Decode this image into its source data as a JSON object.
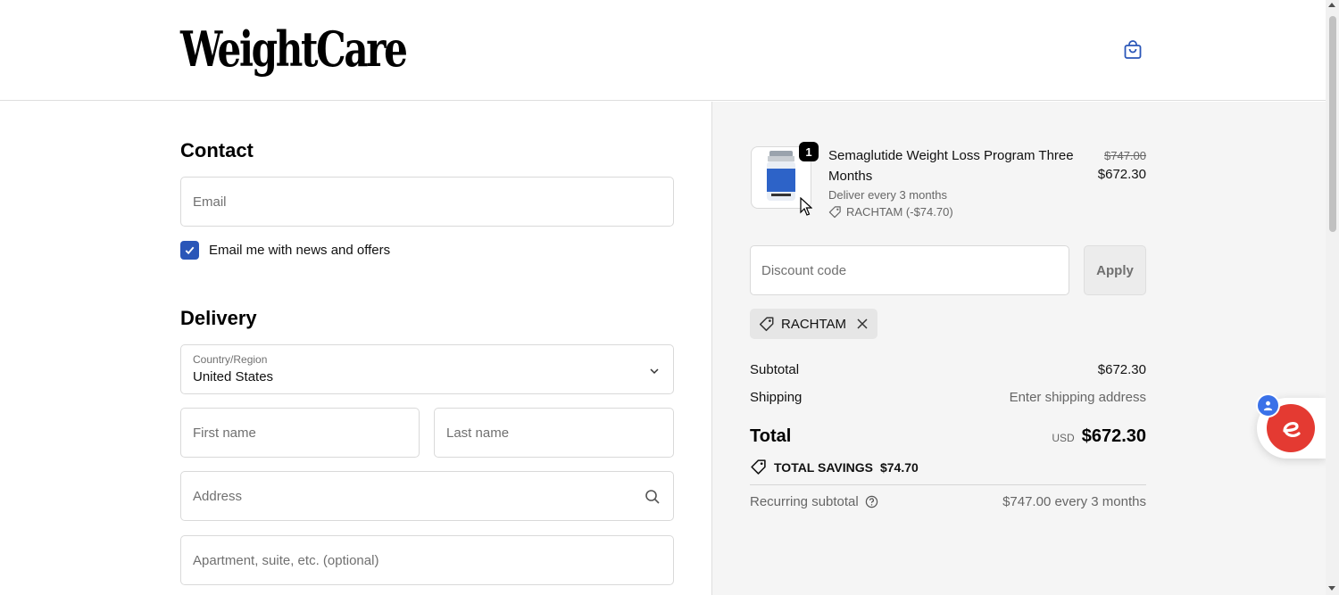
{
  "header": {
    "logo_text": "WeightCare",
    "cart_icon": "shopping-bag-icon"
  },
  "contact": {
    "title": "Contact",
    "email_placeholder": "Email",
    "email_value": "",
    "newsletter_label": "Email me with news and offers",
    "newsletter_checked": true
  },
  "delivery": {
    "title": "Delivery",
    "country_label": "Country/Region",
    "country_value": "United States",
    "first_name_placeholder": "First name",
    "last_name_placeholder": "Last name",
    "address_placeholder": "Address",
    "apartment_placeholder": "Apartment, suite, etc. (optional)"
  },
  "order": {
    "product": {
      "quantity": "1",
      "name": "Semaglutide Weight Loss Program Three Months",
      "subscription": "Deliver every 3 months",
      "discount_line": "RACHTAM (-$74.70)",
      "price_original": "$747.00",
      "price_current": "$672.30"
    },
    "discount_placeholder": "Discount code",
    "apply_label": "Apply",
    "applied_code": "RACHTAM",
    "subtotal_label": "Subtotal",
    "subtotal_value": "$672.30",
    "shipping_label": "Shipping",
    "shipping_value": "Enter shipping address",
    "total_label": "Total",
    "total_currency": "USD",
    "total_value": "$672.30",
    "savings_label": "TOTAL SAVINGS",
    "savings_value": "$74.70",
    "recurring_label": "Recurring subtotal",
    "recurring_value": "$747.00 every 3 months"
  },
  "colors": {
    "accent": "#2a56b8",
    "widget": "#e43a32",
    "widget_badge": "#3a71e8",
    "summary_bg": "#f5f5f5"
  }
}
